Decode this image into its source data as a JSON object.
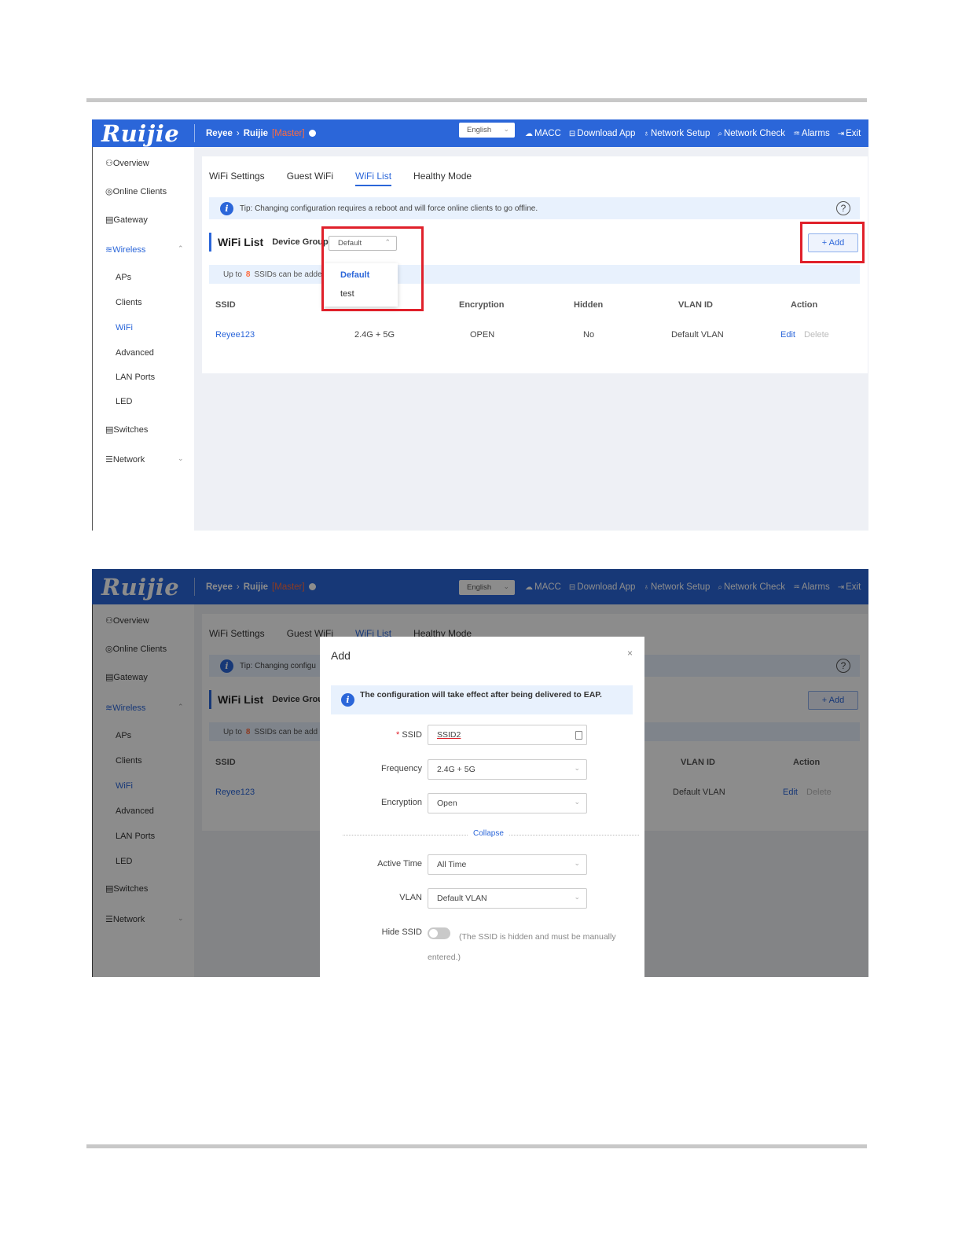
{
  "brand": {
    "logo": "Ruijie",
    "accent": "#2b66d9",
    "warning": "#ff6a3d",
    "highlight": "#e0202a"
  },
  "header": {
    "crumb_root": "Reyee",
    "crumb_device": "Ruijie",
    "crumb_role": "[Master]",
    "language": "English",
    "links": [
      {
        "icon": "cloud-icon",
        "label": "MACC"
      },
      {
        "icon": "download-icon",
        "label": "Download App"
      },
      {
        "icon": "network-setup-icon",
        "label": "Network Setup"
      },
      {
        "icon": "network-check-icon",
        "label": "Network Check"
      },
      {
        "icon": "alarm-icon",
        "label": "Alarms"
      },
      {
        "icon": "exit-icon",
        "label": "Exit"
      }
    ]
  },
  "sidebar": {
    "items": [
      {
        "label": "Overview",
        "icon": "overview-icon"
      },
      {
        "label": "Online Clients",
        "icon": "clients-icon"
      },
      {
        "label": "Gateway",
        "icon": "gateway-icon"
      },
      {
        "label": "Wireless",
        "icon": "wifi-icon"
      },
      {
        "label": "APs"
      },
      {
        "label": "Clients"
      },
      {
        "label": "WiFi"
      },
      {
        "label": "Advanced"
      },
      {
        "label": "LAN Ports"
      },
      {
        "label": "LED"
      },
      {
        "label": "Switches",
        "icon": "switch-icon"
      },
      {
        "label": "Network",
        "icon": "network-icon"
      }
    ]
  },
  "tabs": [
    "WiFi Settings",
    "Guest WiFi",
    "WiFi List",
    "Healthy Mode"
  ],
  "tip": "Tip: Changing configuration requires a reboot and will force online clients to go offline.",
  "tip_short": "Tip: Changing configu",
  "wifi_list": {
    "title": "WiFi List",
    "group_label": "Device Group:",
    "group_label_short": "Device Grou",
    "group_value": "Default",
    "group_options": [
      "Default",
      "test"
    ],
    "add_label": "+ Add",
    "limit_prefix": "Up to",
    "limit_count": "8",
    "limit_suffix": "SSIDs can be added.",
    "limit_suffix_short": "SSIDs can be add",
    "columns": [
      "SSID",
      "Encryption",
      "Hidden",
      "VLAN ID",
      "Action"
    ],
    "rows": [
      {
        "ssid": "Reyee123",
        "frequency": "2.4G + 5G",
        "encryption": "OPEN",
        "hidden": "No",
        "vlan": "Default VLAN",
        "edit": "Edit",
        "delete": "Delete"
      }
    ]
  },
  "modal": {
    "title": "Add",
    "close": "×",
    "note": "The configuration will take effect after being delivered to EAP.",
    "fields": {
      "ssid_label": "SSID",
      "ssid_value": "SSID2",
      "frequency_label": "Frequency",
      "frequency_value": "2.4G + 5G",
      "encryption_label": "Encryption",
      "encryption_value": "Open",
      "collapse": "Collapse",
      "active_time_label": "Active Time",
      "active_time_value": "All Time",
      "vlan_label": "VLAN",
      "vlan_value": "Default VLAN",
      "hide_ssid_label": "Hide SSID",
      "hide_ssid_note": "(The SSID is hidden and must be manually entered.)"
    }
  }
}
